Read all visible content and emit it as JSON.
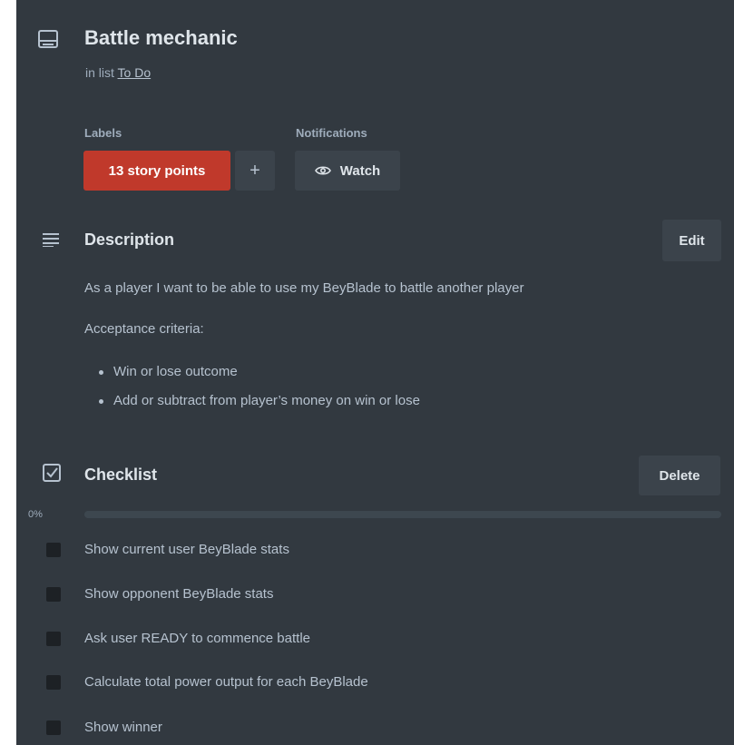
{
  "card": {
    "title": "Battle mechanic",
    "in_list_prefix": "in list",
    "list_name": "To Do"
  },
  "labels": {
    "heading": "Labels",
    "items": [
      {
        "text": "13 story points",
        "color": "#c0392b"
      }
    ],
    "add_symbol": "+"
  },
  "notifications": {
    "heading": "Notifications",
    "watch_label": "Watch",
    "watch_icon": "eye-icon"
  },
  "description": {
    "heading": "Description",
    "icon": "description-lines-icon",
    "edit_label": "Edit",
    "paragraph": "As a player I want to be able to use my BeyBlade to battle another player",
    "criteria_heading": "Acceptance criteria:",
    "bullets": [
      "Win or lose outcome",
      "Add or subtract from player’s money on win or lose"
    ]
  },
  "checklist": {
    "heading": "Checklist",
    "icon": "checkbox-checked-icon",
    "delete_label": "Delete",
    "progress_text": "0%",
    "progress_value": 0,
    "items": [
      {
        "text": "Show current user BeyBlade stats",
        "checked": false
      },
      {
        "text": "Show opponent BeyBlade stats",
        "checked": false
      },
      {
        "text": "Ask user READY to commence battle",
        "checked": false
      },
      {
        "text": "Calculate total power output for each BeyBlade",
        "checked": false
      },
      {
        "text": "Show winner",
        "checked": false
      }
    ]
  },
  "colors": {
    "panel_background": "#323940",
    "label_red": "#c0392b",
    "button_background": "#3b434b",
    "text_primary": "#dfe5ea",
    "text_secondary": "#b6c2cf"
  }
}
